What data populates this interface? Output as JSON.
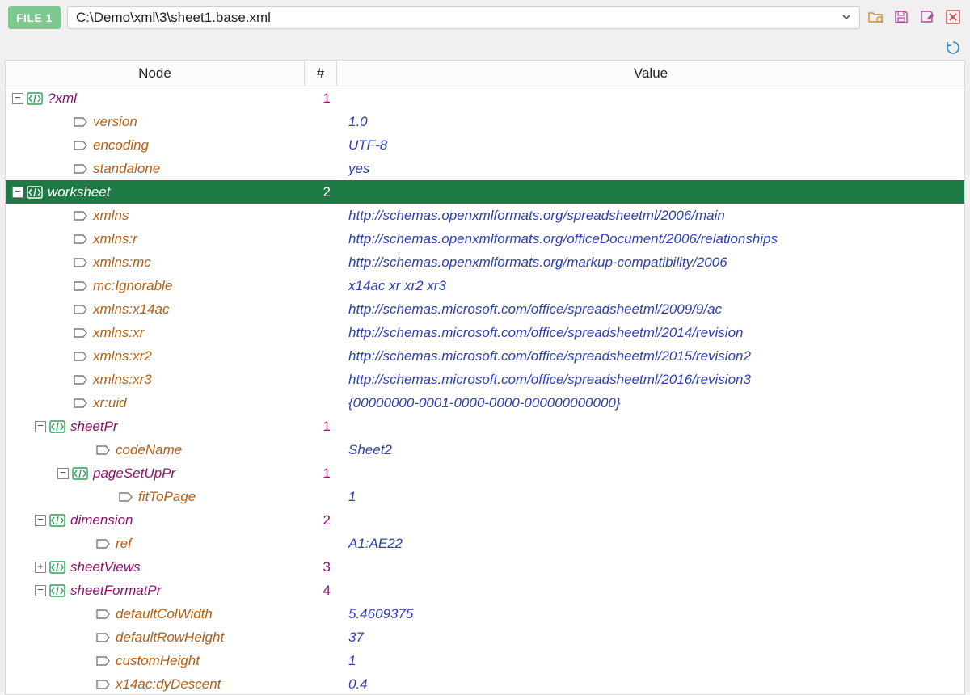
{
  "toolbar": {
    "file_badge": "FILE 1",
    "path": "C:\\Demo\\xml\\3\\sheet1.base.xml"
  },
  "columns": {
    "node": "Node",
    "num": "#",
    "value": "Value"
  },
  "rows": [
    {
      "indent": 0,
      "toggle": "minus",
      "kind": "elem",
      "name": "?xml",
      "num": "1",
      "value": "",
      "sel": false
    },
    {
      "indent": 2,
      "toggle": "",
      "kind": "attr",
      "name": "version",
      "num": "",
      "value": "1.0",
      "sel": false
    },
    {
      "indent": 2,
      "toggle": "",
      "kind": "attr",
      "name": "encoding",
      "num": "",
      "value": "UTF-8",
      "sel": false
    },
    {
      "indent": 2,
      "toggle": "",
      "kind": "attr",
      "name": "standalone",
      "num": "",
      "value": "yes",
      "sel": false
    },
    {
      "indent": 0,
      "toggle": "minus",
      "kind": "elem",
      "name": "worksheet",
      "num": "2",
      "value": "",
      "sel": true
    },
    {
      "indent": 2,
      "toggle": "",
      "kind": "attr",
      "name": "xmlns",
      "num": "",
      "value": "http://schemas.openxmlformats.org/spreadsheetml/2006/main",
      "sel": false
    },
    {
      "indent": 2,
      "toggle": "",
      "kind": "attr",
      "name": "xmlns:r",
      "num": "",
      "value": "http://schemas.openxmlformats.org/officeDocument/2006/relationships",
      "sel": false
    },
    {
      "indent": 2,
      "toggle": "",
      "kind": "attr",
      "name": "xmlns:mc",
      "num": "",
      "value": "http://schemas.openxmlformats.org/markup-compatibility/2006",
      "sel": false
    },
    {
      "indent": 2,
      "toggle": "",
      "kind": "attr",
      "name": "mc:Ignorable",
      "num": "",
      "value": "x14ac xr xr2 xr3",
      "sel": false
    },
    {
      "indent": 2,
      "toggle": "",
      "kind": "attr",
      "name": "xmlns:x14ac",
      "num": "",
      "value": "http://schemas.microsoft.com/office/spreadsheetml/2009/9/ac",
      "sel": false
    },
    {
      "indent": 2,
      "toggle": "",
      "kind": "attr",
      "name": "xmlns:xr",
      "num": "",
      "value": "http://schemas.microsoft.com/office/spreadsheetml/2014/revision",
      "sel": false
    },
    {
      "indent": 2,
      "toggle": "",
      "kind": "attr",
      "name": "xmlns:xr2",
      "num": "",
      "value": "http://schemas.microsoft.com/office/spreadsheetml/2015/revision2",
      "sel": false
    },
    {
      "indent": 2,
      "toggle": "",
      "kind": "attr",
      "name": "xmlns:xr3",
      "num": "",
      "value": "http://schemas.microsoft.com/office/spreadsheetml/2016/revision3",
      "sel": false
    },
    {
      "indent": 2,
      "toggle": "",
      "kind": "attr",
      "name": "xr:uid",
      "num": "",
      "value": "{00000000-0001-0000-0000-000000000000}",
      "sel": false
    },
    {
      "indent": 1,
      "toggle": "minus",
      "kind": "elem",
      "name": "sheetPr",
      "num": "1",
      "value": "",
      "sel": false
    },
    {
      "indent": 3,
      "toggle": "",
      "kind": "attr",
      "name": "codeName",
      "num": "",
      "value": "Sheet2",
      "sel": false
    },
    {
      "indent": 2,
      "toggle": "minus",
      "kind": "elem",
      "name": "pageSetUpPr",
      "num": "1",
      "value": "",
      "sel": false
    },
    {
      "indent": 4,
      "toggle": "",
      "kind": "attr",
      "name": "fitToPage",
      "num": "",
      "value": "1",
      "sel": false
    },
    {
      "indent": 1,
      "toggle": "minus",
      "kind": "elem",
      "name": "dimension",
      "num": "2",
      "value": "",
      "sel": false
    },
    {
      "indent": 3,
      "toggle": "",
      "kind": "attr",
      "name": "ref",
      "num": "",
      "value": "A1:AE22",
      "sel": false
    },
    {
      "indent": 1,
      "toggle": "plus",
      "kind": "elem",
      "name": "sheetViews",
      "num": "3",
      "value": "",
      "sel": false
    },
    {
      "indent": 1,
      "toggle": "minus",
      "kind": "elem",
      "name": "sheetFormatPr",
      "num": "4",
      "value": "",
      "sel": false
    },
    {
      "indent": 3,
      "toggle": "",
      "kind": "attr",
      "name": "defaultColWidth",
      "num": "",
      "value": "5.4609375",
      "sel": false
    },
    {
      "indent": 3,
      "toggle": "",
      "kind": "attr",
      "name": "defaultRowHeight",
      "num": "",
      "value": "37",
      "sel": false
    },
    {
      "indent": 3,
      "toggle": "",
      "kind": "attr",
      "name": "customHeight",
      "num": "",
      "value": "1",
      "sel": false
    },
    {
      "indent": 3,
      "toggle": "",
      "kind": "attr",
      "name": "x14ac:dyDescent",
      "num": "",
      "value": "0.4",
      "sel": false
    }
  ]
}
